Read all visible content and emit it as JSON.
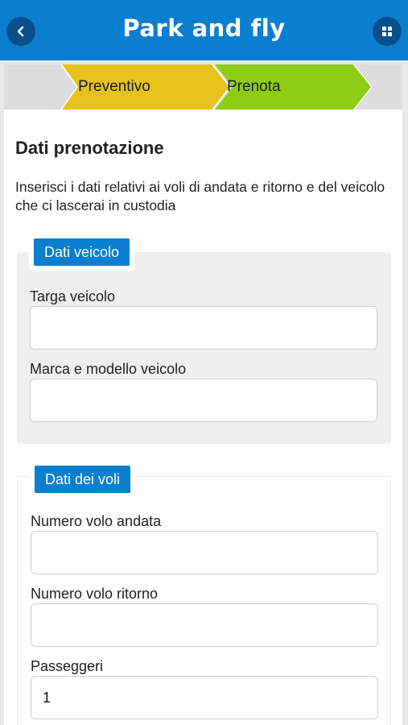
{
  "header": {
    "title": "Park and fly",
    "back_icon": "chevron-left-icon",
    "menu_icon": "grid-icon",
    "color": "#0a7fd0"
  },
  "steps": [
    {
      "label": "Preventivo",
      "color": "#e6c31c",
      "state": "completed"
    },
    {
      "label": "Prenota",
      "color": "#8fcc14",
      "state": "active"
    }
  ],
  "page": {
    "heading": "Dati prenotazione",
    "intro": "Inserisci i dati relativi ai voli di andata e ritorno e del veicolo che ci lascerai in custodia"
  },
  "vehicle": {
    "legend": "Dati veicolo",
    "plate_label": "Targa veicolo",
    "plate_value": "",
    "model_label": "Marca e modello veicolo",
    "model_value": ""
  },
  "flights": {
    "legend": "Dati dei voli",
    "outbound_label": "Numero volo andata",
    "outbound_value": "",
    "return_label": "Numero volo ritorno",
    "return_value": "",
    "passengers_label": "Passeggeri",
    "passengers_value": "1"
  }
}
